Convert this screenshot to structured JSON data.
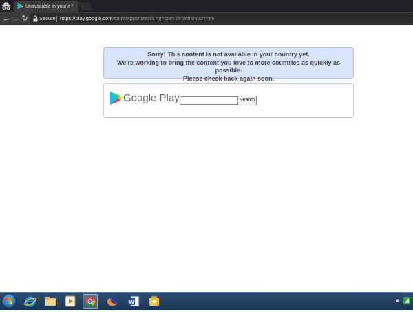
{
  "browser": {
    "tab": {
      "title": "Unavailable in your country",
      "close_glyph": "×"
    },
    "toolbar": {
      "back_glyph": "←",
      "forward_glyph": "→",
      "reload_glyph": "↻",
      "secure_label": "Secure",
      "url_host": "https://play.google.com",
      "url_path": "/store/apps/details?id=com.bif.withinc&hl=en"
    }
  },
  "page": {
    "notice": {
      "lines": [
        "Sorry! This content is not available in your country yet.",
        "We're working to bring the content you love to more countries as quickly as possible.",
        "Please check back again soon."
      ],
      "background_color": "#d7e4fb"
    },
    "google_play": {
      "wordmark": "Google Play",
      "search_value": "",
      "search_button_label": "Search"
    }
  },
  "taskbar": {
    "icons": [
      "start-orb",
      "internet-explorer",
      "file-explorer",
      "media-player",
      "chrome",
      "firefox",
      "word",
      "utility-app"
    ],
    "active_icon": "chrome"
  }
}
